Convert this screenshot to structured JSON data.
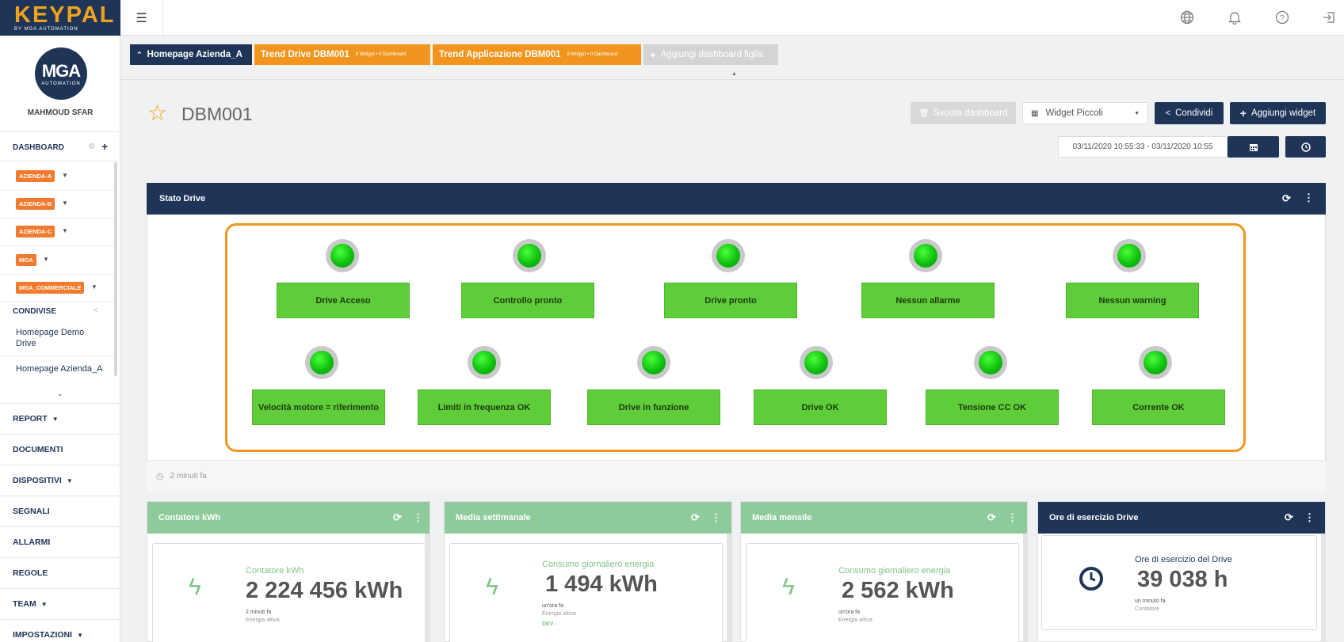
{
  "brand": {
    "logo_main": "KEYPAL",
    "logo_sub": "BY MGA AUTOMATION",
    "avatar_main": "MGA",
    "avatar_sub": "AUTOMATION"
  },
  "user": {
    "name": "MAHMOUD SFAR"
  },
  "sidebar": {
    "dashboard_label": "DASHBOARD",
    "workspaces": [
      {
        "label": "AZIENDA-A"
      },
      {
        "label": "AZIENDA-B"
      },
      {
        "label": "AZIENDA-C"
      },
      {
        "label": "MGA"
      },
      {
        "label": "MGA_COMMERCIALE"
      }
    ],
    "shared_label": "CONDIVISE",
    "shared_items": [
      "Homepage Demo Drive",
      "Homepage Azienda_A"
    ],
    "nav": [
      {
        "label": "REPORT",
        "caret": true
      },
      {
        "label": "DOCUMENTI",
        "caret": false
      },
      {
        "label": "DISPOSITIVI",
        "caret": true
      },
      {
        "label": "SEGNALI",
        "caret": false
      },
      {
        "label": "ALLARMI",
        "caret": false
      },
      {
        "label": "REGOLE",
        "caret": false
      },
      {
        "label": "TEAM",
        "caret": true
      },
      {
        "label": "IMPOSTAZIONI",
        "caret": true
      }
    ]
  },
  "tabs": [
    {
      "label": "Homepage Azienda_A",
      "info": "",
      "color": "#1e3558"
    },
    {
      "label": "Trend Drive DBM001",
      "info": "9 Widget • 0 Dashboard",
      "color": "#f2951e"
    },
    {
      "label": "Trend Applicazione DBM001",
      "info": "8 Widget • 0 Dashboard",
      "color": "#f2951e"
    },
    {
      "label": "Aggiungi dashboard figlia",
      "info": "",
      "color": "#d4d4d4"
    }
  ],
  "page": {
    "title": "DBM001",
    "svuota_label": "Svuota dashboard",
    "widget_size_value": "Widget Piccoli",
    "condividi_label": "Condividi",
    "aggiungi_label": "Aggiungi widget",
    "date_range": "03/11/2020 10:55:33 - 03/11/2020 10:55"
  },
  "stato_drive": {
    "title": "Stato Drive",
    "row1": [
      "Drive Acceso",
      "Controllo pronto",
      "Drive pronto",
      "Nessun allarme",
      "Nessun warning"
    ],
    "row2": [
      "Velocità motore = riferimento",
      "Limiti in frequenza OK",
      "Drive in funzione",
      "Drive OK",
      "Tensione CC OK",
      "Corrente OK"
    ],
    "led_color": "#1fd11a",
    "updated": "2 minuti fa"
  },
  "widgets": [
    {
      "title": "Contatore kWh",
      "label": "Contatore kWh",
      "value": "2 224 456 kWh",
      "time": "2 minuti fa",
      "desc": "Energia attiva",
      "extra": "",
      "icon": "bolt-icon"
    },
    {
      "title": "Media settimanale",
      "label": "Consumo giornaliero energia",
      "value": "1 494 kWh",
      "time": "un'ora fa",
      "desc": "Energia attiva",
      "extra": "DEV -",
      "icon": "bolt-icon"
    },
    {
      "title": "Media mensile",
      "label": "Consumo giornaliero energia",
      "value": "2 562 kWh",
      "time": "un'ora fa",
      "desc": "Energia attiva",
      "extra": "",
      "icon": "bolt-icon"
    },
    {
      "title": "Ore di esercizio Drive",
      "label": "Ore di esercizio del Drive",
      "value": "39 038 h",
      "time": "un minuto fa",
      "desc": "Contatore",
      "extra": "",
      "icon": "clock-icon"
    }
  ],
  "colors": {
    "navy": "#1e3558",
    "orange": "#f2951e",
    "green": "#5fcc3a",
    "widget_green": "#8ecb9b"
  }
}
